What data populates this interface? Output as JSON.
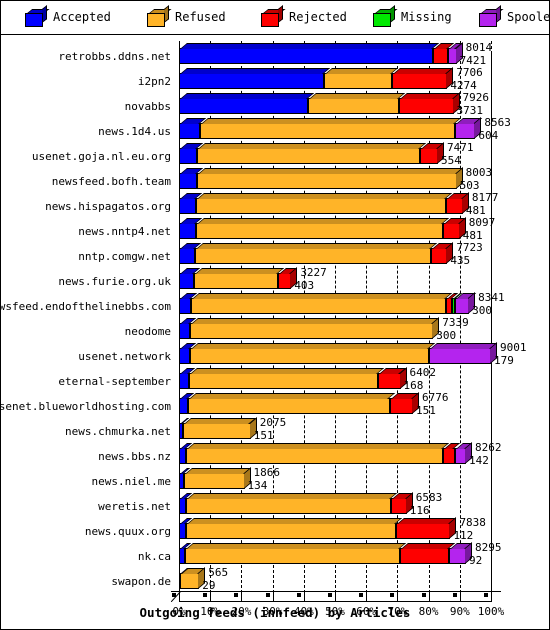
{
  "legend": {
    "items": [
      {
        "label": "Accepted",
        "color": "#0000ff",
        "icon": "cube-icon"
      },
      {
        "label": "Refused",
        "color": "#ffb428",
        "icon": "cube-icon"
      },
      {
        "label": "Rejected",
        "color": "#fe0000",
        "icon": "cube-icon"
      },
      {
        "label": "Missing",
        "color": "#00e800",
        "icon": "cube-icon"
      },
      {
        "label": "Spooled",
        "color": "#b424ee",
        "icon": "cube-icon"
      }
    ]
  },
  "chart_data": {
    "type": "bar",
    "orientation": "horizontal",
    "stacked": true,
    "percent_scale": true,
    "title": "Outgoing feeds (innfeed) by Articles",
    "xlabel": "",
    "ylabel": "",
    "xlim": [
      0,
      100
    ],
    "xticks": [
      "0%",
      "10%",
      "20%",
      "30%",
      "40%",
      "50%",
      "60%",
      "70%",
      "80%",
      "90%",
      "100%"
    ],
    "grid": true,
    "legend_position": "top",
    "series_names": [
      "Accepted",
      "Refused",
      "Rejected",
      "Missing",
      "Spooled"
    ],
    "series_colors": [
      "#0000ff",
      "#ffb428",
      "#fe0000",
      "#00e800",
      "#b424ee"
    ],
    "categories": [
      "retrobbs.ddns.net",
      "i2pn2",
      "novabbs",
      "news.1d4.us",
      "usenet.goja.nl.eu.org",
      "newsfeed.bofh.team",
      "news.hispagatos.org",
      "news.nntp4.net",
      "nntp.comgw.net",
      "news.furie.org.uk",
      "newsfeed.endofthelinebbs.com",
      "neodome",
      "usenet.network",
      "eternal-september",
      "usenet.blueworldhosting.com",
      "news.chmurka.net",
      "news.bbs.nz",
      "news.niel.me",
      "weretis.net",
      "news.quux.org",
      "nk.ca",
      "swapon.de"
    ],
    "rows": [
      {
        "label": "retrobbs.ddns.net",
        "total": 8014,
        "secondary": 7421,
        "bar_percent": 89.0,
        "segments": [
          {
            "name": "Accepted",
            "pct": 91.5
          },
          {
            "name": "Rejected",
            "pct": 5.5
          },
          {
            "name": "Spooled",
            "pct": 3.0
          }
        ]
      },
      {
        "label": "i2pn2",
        "total": 7706,
        "secondary": 4274,
        "bar_percent": 86.0,
        "segments": [
          {
            "name": "Accepted",
            "pct": 54.0
          },
          {
            "name": "Refused",
            "pct": 25.5
          },
          {
            "name": "Rejected",
            "pct": 20.5
          }
        ]
      },
      {
        "label": "novabbs",
        "total": 7926,
        "secondary": 3731,
        "bar_percent": 88.0,
        "segments": [
          {
            "name": "Accepted",
            "pct": 47.0
          },
          {
            "name": "Refused",
            "pct": 33.0
          },
          {
            "name": "Rejected",
            "pct": 20.0
          }
        ]
      },
      {
        "label": "news.1d4.us",
        "total": 8563,
        "secondary": 604,
        "bar_percent": 95.0,
        "segments": [
          {
            "name": "Accepted",
            "pct": 7.0
          },
          {
            "name": "Refused",
            "pct": 86.0
          },
          {
            "name": "Spooled",
            "pct": 7.0
          }
        ]
      },
      {
        "label": "usenet.goja.nl.eu.org",
        "total": 7471,
        "secondary": 554,
        "bar_percent": 83.0,
        "segments": [
          {
            "name": "Accepted",
            "pct": 7.0
          },
          {
            "name": "Refused",
            "pct": 86.0
          },
          {
            "name": "Rejected",
            "pct": 7.0
          }
        ]
      },
      {
        "label": "newsfeed.bofh.team",
        "total": 8003,
        "secondary": 503,
        "bar_percent": 89.0,
        "segments": [
          {
            "name": "Accepted",
            "pct": 6.5
          },
          {
            "name": "Refused",
            "pct": 93.5
          }
        ]
      },
      {
        "label": "news.hispagatos.org",
        "total": 8177,
        "secondary": 481,
        "bar_percent": 91.0,
        "segments": [
          {
            "name": "Accepted",
            "pct": 6.0
          },
          {
            "name": "Refused",
            "pct": 88.0
          },
          {
            "name": "Rejected",
            "pct": 6.0
          }
        ]
      },
      {
        "label": "news.nntp4.net",
        "total": 8097,
        "secondary": 481,
        "bar_percent": 90.0,
        "segments": [
          {
            "name": "Accepted",
            "pct": 6.0
          },
          {
            "name": "Refused",
            "pct": 88.0
          },
          {
            "name": "Rejected",
            "pct": 6.0
          }
        ]
      },
      {
        "label": "nntp.comgw.net",
        "total": 7723,
        "secondary": 435,
        "bar_percent": 86.0,
        "segments": [
          {
            "name": "Accepted",
            "pct": 6.0
          },
          {
            "name": "Refused",
            "pct": 88.0
          },
          {
            "name": "Rejected",
            "pct": 6.0
          }
        ]
      },
      {
        "label": "news.furie.org.uk",
        "total": 3227,
        "secondary": 403,
        "bar_percent": 36.0,
        "segments": [
          {
            "name": "Accepted",
            "pct": 13.0
          },
          {
            "name": "Refused",
            "pct": 75.0
          },
          {
            "name": "Rejected",
            "pct": 12.0
          }
        ]
      },
      {
        "label": "newsfeed.endofthelinebbs.com",
        "total": 8341,
        "secondary": 300,
        "bar_percent": 93.0,
        "segments": [
          {
            "name": "Accepted",
            "pct": 4.0
          },
          {
            "name": "Refused",
            "pct": 88.0
          },
          {
            "name": "Rejected",
            "pct": 2.0
          },
          {
            "name": "Missing",
            "pct": 1.0
          },
          {
            "name": "Spooled",
            "pct": 5.0
          }
        ]
      },
      {
        "label": "neodome",
        "total": 7339,
        "secondary": 300,
        "bar_percent": 81.5,
        "segments": [
          {
            "name": "Accepted",
            "pct": 4.5
          },
          {
            "name": "Refused",
            "pct": 95.5
          }
        ]
      },
      {
        "label": "usenet.network",
        "total": 9001,
        "secondary": 179,
        "bar_percent": 100.0,
        "segments": [
          {
            "name": "Accepted",
            "pct": 3.5
          },
          {
            "name": "Refused",
            "pct": 76.5
          },
          {
            "name": "Spooled",
            "pct": 20.0
          }
        ]
      },
      {
        "label": "eternal-september",
        "total": 6402,
        "secondary": 168,
        "bar_percent": 71.0,
        "segments": [
          {
            "name": "Accepted",
            "pct": 4.5
          },
          {
            "name": "Refused",
            "pct": 85.5
          },
          {
            "name": "Rejected",
            "pct": 10.0
          }
        ]
      },
      {
        "label": "usenet.blueworldhosting.com",
        "total": 6776,
        "secondary": 151,
        "bar_percent": 75.0,
        "segments": [
          {
            "name": "Accepted",
            "pct": 4.0
          },
          {
            "name": "Refused",
            "pct": 86.0
          },
          {
            "name": "Rejected",
            "pct": 10.0
          }
        ]
      },
      {
        "label": "news.chmurka.net",
        "total": 2075,
        "secondary": 151,
        "bar_percent": 23.0,
        "segments": [
          {
            "name": "Accepted",
            "pct": 6.0
          },
          {
            "name": "Refused",
            "pct": 94.0
          }
        ]
      },
      {
        "label": "news.bbs.nz",
        "total": 8262,
        "secondary": 142,
        "bar_percent": 92.0,
        "segments": [
          {
            "name": "Accepted",
            "pct": 2.5
          },
          {
            "name": "Refused",
            "pct": 89.5
          },
          {
            "name": "Rejected",
            "pct": 4.0
          },
          {
            "name": "Spooled",
            "pct": 4.0
          }
        ]
      },
      {
        "label": "news.niel.me",
        "total": 1866,
        "secondary": 134,
        "bar_percent": 21.0,
        "segments": [
          {
            "name": "Accepted",
            "pct": 7.0
          },
          {
            "name": "Refused",
            "pct": 93.0
          }
        ]
      },
      {
        "label": "weretis.net",
        "total": 6583,
        "secondary": 116,
        "bar_percent": 73.0,
        "segments": [
          {
            "name": "Accepted",
            "pct": 3.0
          },
          {
            "name": "Refused",
            "pct": 90.0
          },
          {
            "name": "Rejected",
            "pct": 7.0
          }
        ]
      },
      {
        "label": "news.quux.org",
        "total": 7838,
        "secondary": 112,
        "bar_percent": 87.0,
        "segments": [
          {
            "name": "Accepted",
            "pct": 2.5
          },
          {
            "name": "Refused",
            "pct": 77.5
          },
          {
            "name": "Rejected",
            "pct": 20.0
          }
        ]
      },
      {
        "label": "nk.ca",
        "total": 8295,
        "secondary": 92,
        "bar_percent": 92.0,
        "segments": [
          {
            "name": "Accepted",
            "pct": 2.0
          },
          {
            "name": "Refused",
            "pct": 75.0
          },
          {
            "name": "Rejected",
            "pct": 17.0
          },
          {
            "name": "Spooled",
            "pct": 6.0
          }
        ]
      },
      {
        "label": "swapon.de",
        "total": 565,
        "secondary": 29,
        "bar_percent": 6.5,
        "segments": [
          {
            "name": "Accepted",
            "pct": 5.0
          },
          {
            "name": "Refused",
            "pct": 95.0
          }
        ]
      }
    ]
  }
}
